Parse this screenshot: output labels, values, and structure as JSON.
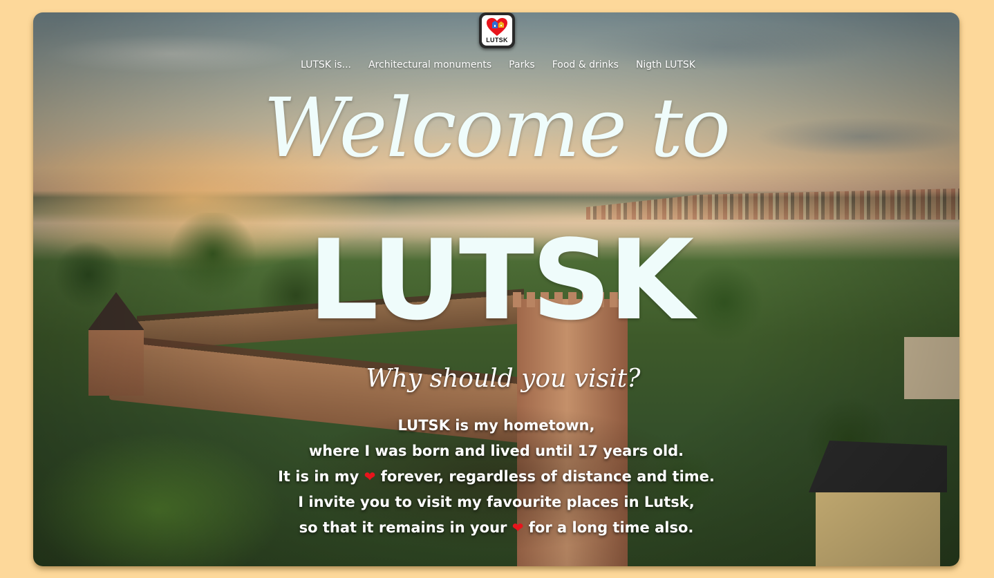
{
  "logo": {
    "text": "LUTSK",
    "heart_color": "#e8141c"
  },
  "nav": {
    "items": [
      {
        "label": "LUTSK is..."
      },
      {
        "label": "Architectural monuments"
      },
      {
        "label": "Parks"
      },
      {
        "label": "Food & drinks"
      },
      {
        "label": "Nigth LUTSK"
      }
    ]
  },
  "hero": {
    "welcome": "Welcome to",
    "city": "LUTSK",
    "subtitle": "Why should you visit?",
    "text_color": "#effcfb"
  },
  "intro": {
    "line1": "LUTSK is my hometown,",
    "line2": "where I was born and lived until 17 years old.",
    "line3_before": "It is in my",
    "line3_after": "forever, regardless of distance and time.",
    "line4": "I invite you to visit my favourite places in Lutsk,",
    "line5_before": "so that it remains in your",
    "line5_after": "for a long time also.",
    "heart_glyph": "❤"
  },
  "page": {
    "background_color": "#fdd89a"
  }
}
